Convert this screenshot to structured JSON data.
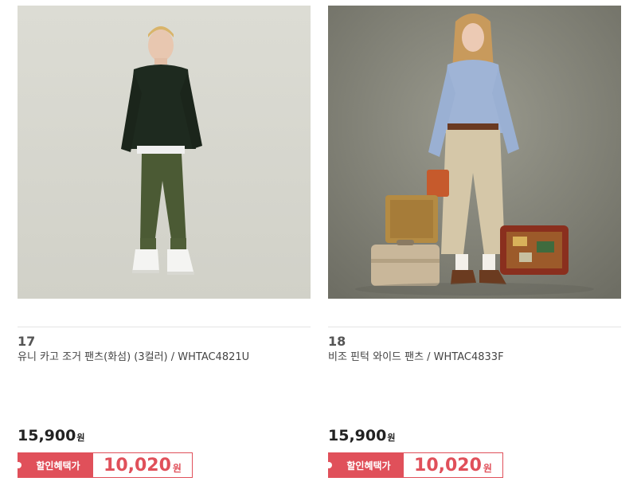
{
  "colors": {
    "accent": "#e0505a",
    "text": "#333333",
    "divider": "#e5e5e5"
  },
  "products": [
    {
      "rank": "17",
      "name": "유니 카고 조거 팬츠(화섬) (3컬러) / WHTAC4821U",
      "price": "15,900",
      "currency": "원",
      "discount_label": "할인혜택가",
      "discount_price": "10,020",
      "discount_currency": "원"
    },
    {
      "rank": "18",
      "name": "비조 핀턱 와이드 팬츠 / WHTAC4833F",
      "price": "15,900",
      "currency": "원",
      "discount_label": "할인혜택가",
      "discount_price": "10,020",
      "discount_currency": "원"
    }
  ]
}
